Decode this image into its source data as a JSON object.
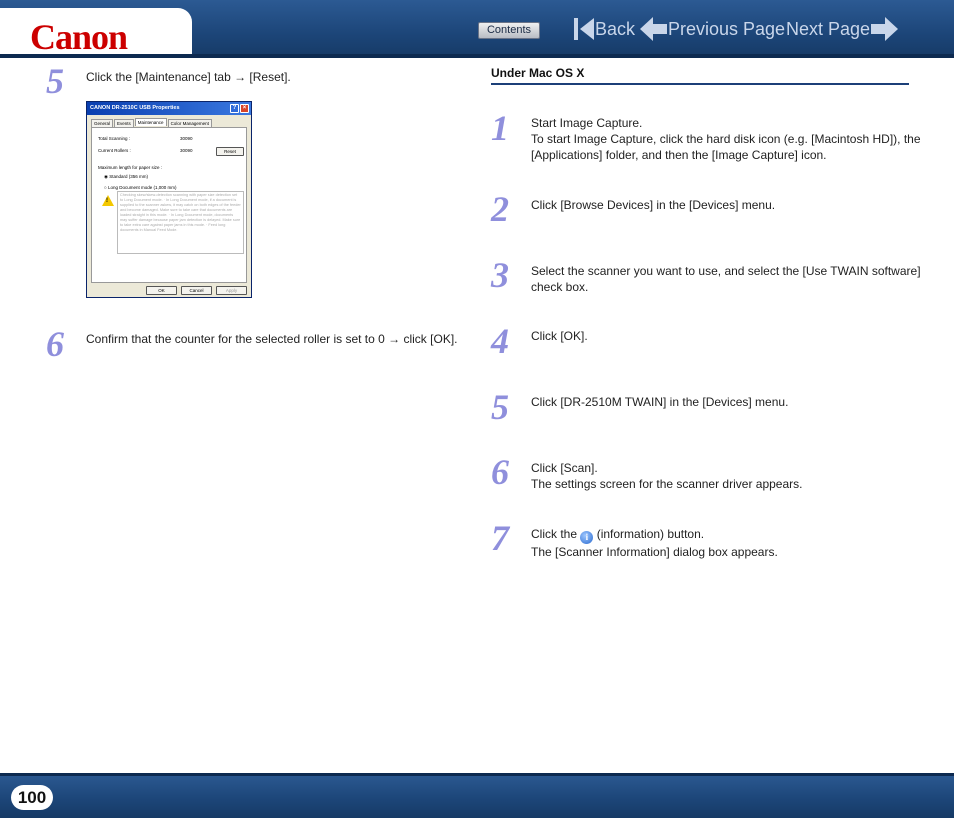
{
  "header": {
    "logo": "Canon",
    "contents_label": "Contents",
    "back_label": "Back",
    "previous_label": "Previous Page",
    "next_label": "Next Page"
  },
  "left_steps": [
    {
      "number": "5",
      "text": "Click the [Maintenance] tab → [Reset]."
    },
    {
      "number": "6",
      "text": "Confirm that the counter for the selected roller is set to 0 → click [OK]."
    }
  ],
  "dialog": {
    "title": "CANON DR-2510C USB Properties",
    "tabs": [
      "General",
      "Events",
      "Maintenance",
      "Color Management"
    ],
    "total_scanning_label": "Total Scanning :",
    "total_scanning_value": "30090",
    "current_rollers_label": "Current Rollers :",
    "current_rollers_value": "30090",
    "reset_label": "Reset",
    "max_length_label": "Maximum length for paper size :",
    "standard_label": "Standard (356 mm)",
    "long_label": "Long Document mode (1,000 mm)",
    "warning_text": "Checking skew/skew-detection scanning with paper size detection set to Long Document mode. · In Long Document mode, if a document is supplied to the scanner askew, it may catch on both edges of the feeder and become damaged. Make sure to take care that documents are loaded straight in this mode. · In Long Document mode, documents may suffer damage because paper jam detection is delayed. Make sure to take extra care against paper jams in this mode. · Feed long documents in Manual Feed Mode.",
    "ok_label": "OK",
    "cancel_label": "Cancel",
    "apply_label": "Apply"
  },
  "mac_section": {
    "title": "Under Mac OS X",
    "steps": [
      {
        "number": "1",
        "line1": "Start Image Capture.",
        "line2": "To start Image Capture, click the hard disk icon (e.g. [Macintosh HD]), the",
        "line3": "[Applications] folder, and then the [Image Capture] icon."
      },
      {
        "number": "2",
        "line1": "Click [Browse Devices] in the [Devices] menu."
      },
      {
        "number": "3",
        "line1": "Select the scanner you want to use, and select the [Use TWAIN software]",
        "line2": "check box."
      },
      {
        "number": "4",
        "line1": "Click [OK]."
      },
      {
        "number": "5",
        "line1": "Click [DR-2510M TWAIN] in the [Devices] menu."
      },
      {
        "number": "6",
        "line1": "Click [Scan].",
        "line2": "The settings screen for the scanner driver appears."
      },
      {
        "number": "7",
        "line1_before": "Click the",
        "line1_after": "(information) button.",
        "line2": "The [Scanner Information] dialog box appears."
      }
    ]
  },
  "footer": {
    "page_number": "100"
  },
  "colors": {
    "header_blue": "#1c4578",
    "step_number": "#8f8fdc",
    "logo_red": "#cc0000"
  }
}
